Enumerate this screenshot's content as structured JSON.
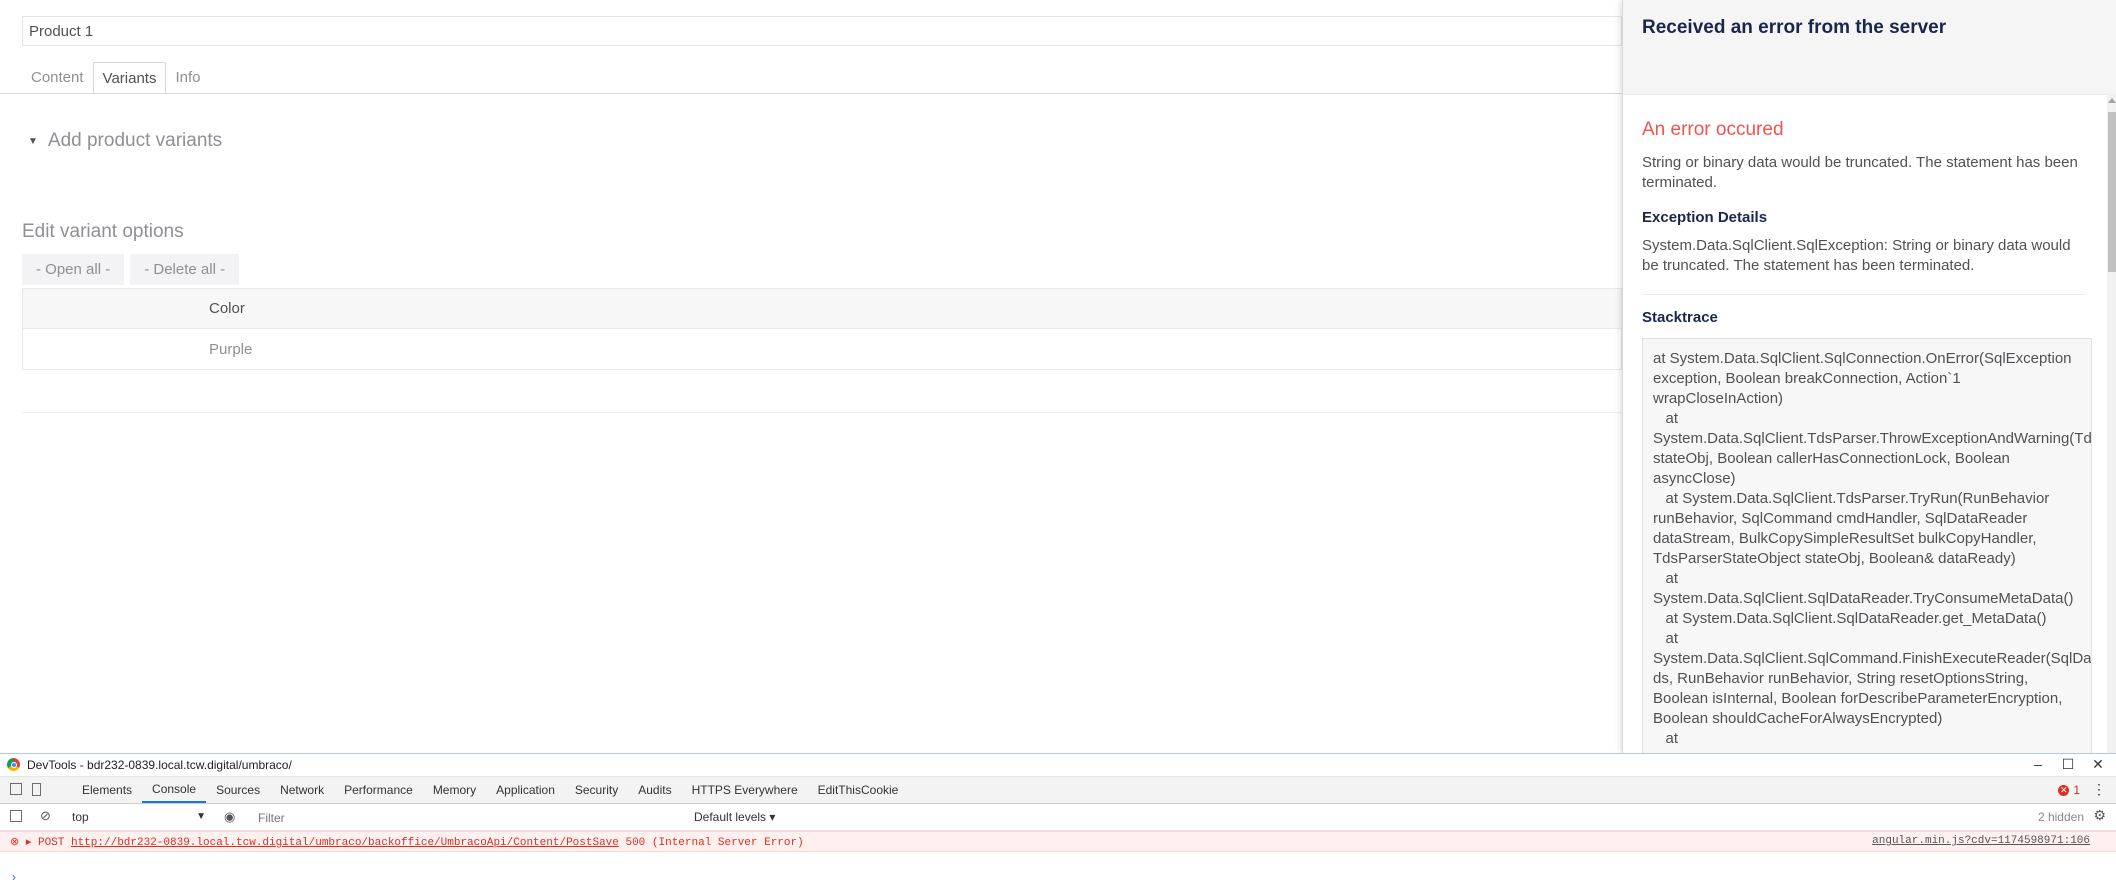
{
  "editor": {
    "name_value": "Product 1",
    "tabs": [
      {
        "label": "Content"
      },
      {
        "label": "Variants"
      },
      {
        "label": "Info"
      }
    ],
    "add_variants_label": "Add product variants",
    "edit_options_title": "Edit variant options",
    "open_all_label": "- Open all -",
    "delete_all_label": "- Delete all -",
    "table": {
      "column_header": "Color",
      "rows": [
        {
          "color": "Purple"
        }
      ]
    }
  },
  "error_panel": {
    "title": "Received an error from the server",
    "error_heading": "An error occured",
    "error_message": "String or binary data would be truncated. The statement has been terminated.",
    "exception_label": "Exception Details",
    "exception_text": "System.Data.SqlClient.SqlException: String or binary data would be truncated. The statement has been terminated.",
    "stacktrace_label": "Stacktrace",
    "stacktrace": "at System.Data.SqlClient.SqlConnection.OnError(SqlException exception, Boolean breakConnection, Action`1 wrapCloseInAction)\n   at System.Data.SqlClient.TdsParser.ThrowExceptionAndWarning(TdsParserStateObject stateObj, Boolean callerHasConnectionLock, Boolean asyncClose)\n   at System.Data.SqlClient.TdsParser.TryRun(RunBehavior runBehavior, SqlCommand cmdHandler, SqlDataReader dataStream, BulkCopySimpleResultSet bulkCopyHandler, TdsParserStateObject stateObj, Boolean& dataReady)\n   at System.Data.SqlClient.SqlDataReader.TryConsumeMetaData()\n   at System.Data.SqlClient.SqlDataReader.get_MetaData()\n   at System.Data.SqlClient.SqlCommand.FinishExecuteReader(SqlDataReader ds, RunBehavior runBehavior, String resetOptionsString, Boolean isInternal, Boolean forDescribeParameterEncryption, Boolean shouldCacheForAlwaysEncrypted)\n   at"
  },
  "devtools": {
    "window_title": "DevTools - bdr232-0839.local.tcw.digital/umbraco/",
    "tabs": [
      {
        "label": "Elements"
      },
      {
        "label": "Console"
      },
      {
        "label": "Sources"
      },
      {
        "label": "Network"
      },
      {
        "label": "Performance"
      },
      {
        "label": "Memory"
      },
      {
        "label": "Application"
      },
      {
        "label": "Security"
      },
      {
        "label": "Audits"
      },
      {
        "label": "HTTPS Everywhere"
      },
      {
        "label": "EditThisCookie"
      }
    ],
    "active_tab": "Console",
    "error_count": "1",
    "context": "top",
    "filter_placeholder": "Filter",
    "levels_label": "Default levels",
    "hidden_count": "2 hidden",
    "console_error": {
      "method": "POST",
      "url": "http://bdr232-0839.local.tcw.digital/umbraco/backoffice/UmbracoApi/Content/PostSave",
      "status": "500 (Internal Server Error)",
      "source": "angular.min.js?cdv=1174598971:106"
    },
    "colors": {
      "accent": "#1a73e8",
      "error": "#d93025"
    }
  },
  "icons": {
    "caret": "caret-down-icon",
    "window_min": "minimize-icon",
    "window_max": "maximize-icon",
    "window_close": "close-icon"
  }
}
